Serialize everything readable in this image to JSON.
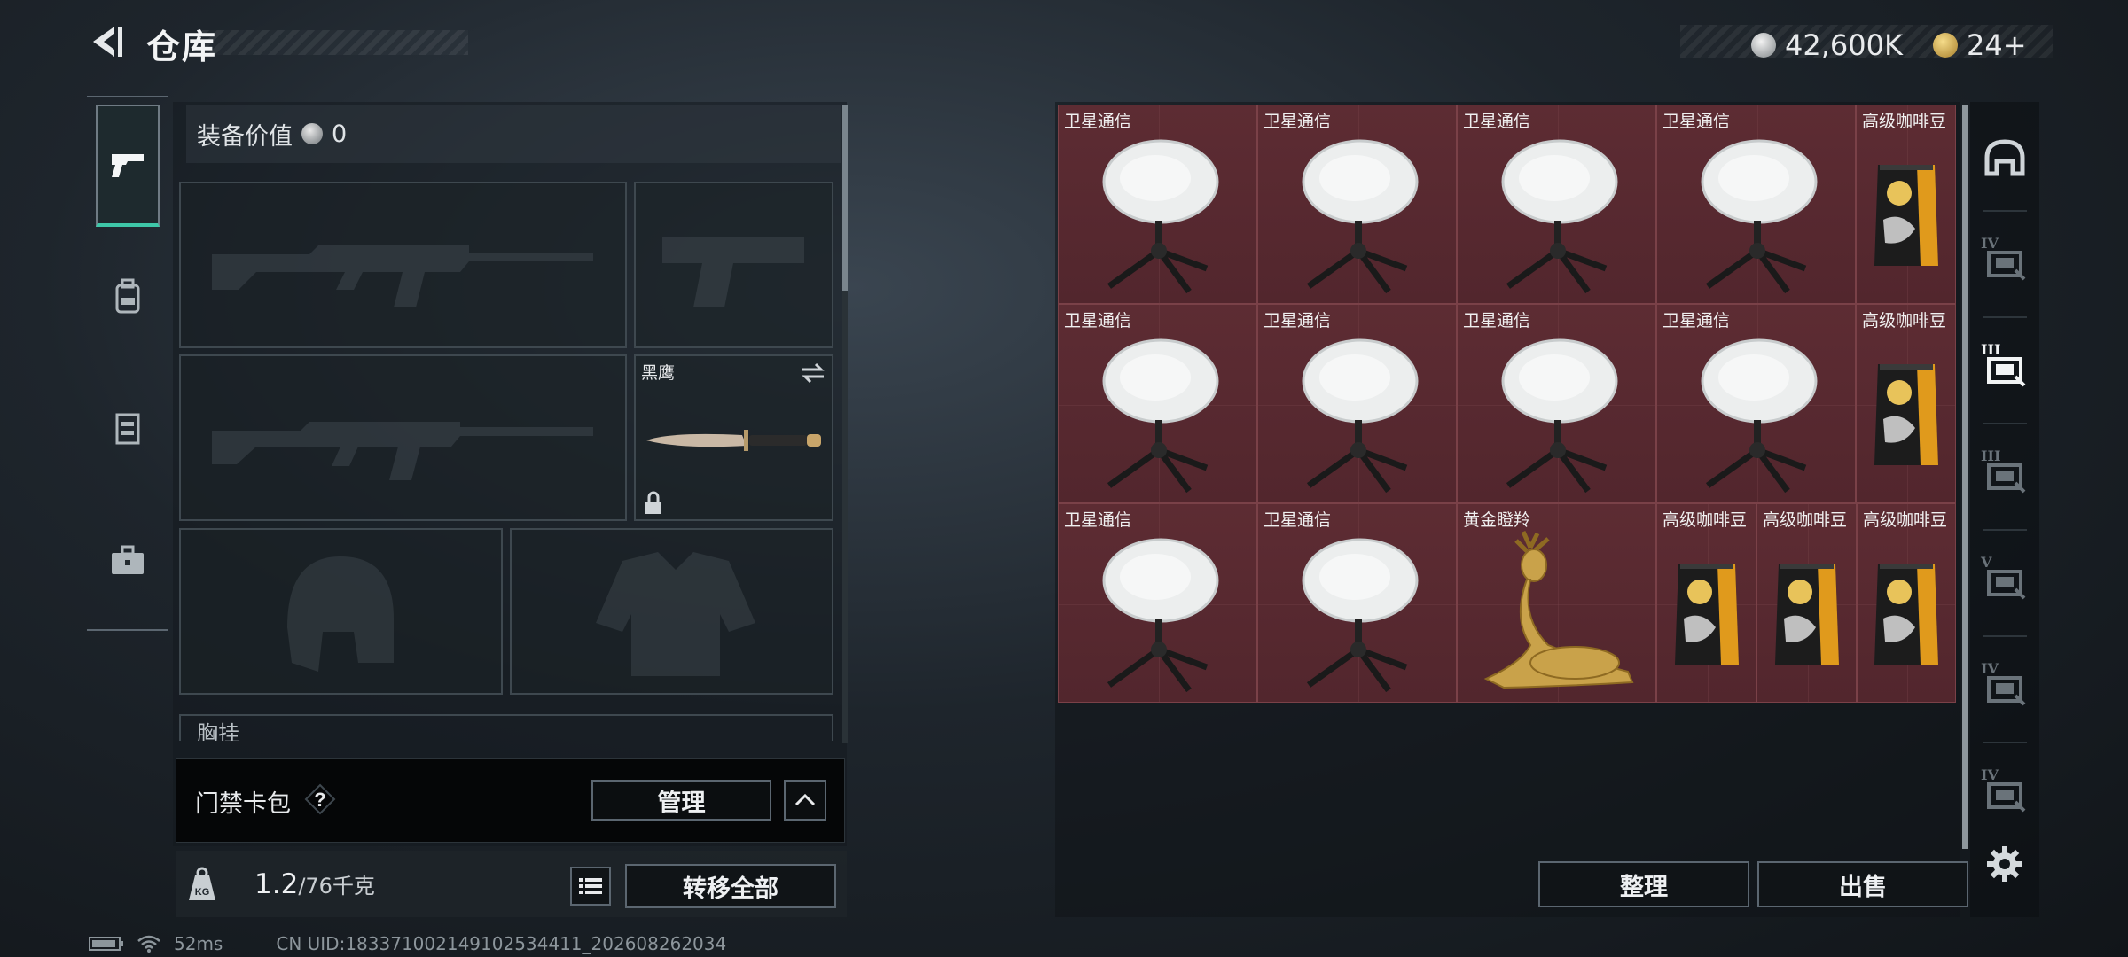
{
  "header": {
    "title": "仓库",
    "currency_primary": "42,600K",
    "currency_secondary": "24+"
  },
  "left_tabs": [
    {
      "icon": "pistol-icon",
      "active": true
    },
    {
      "icon": "backpack-icon",
      "active": false
    },
    {
      "icon": "vest-icon",
      "active": false
    },
    {
      "icon": "briefcase-icon",
      "active": false
    }
  ],
  "equipment": {
    "value_label": "装备价值",
    "value": "0",
    "melee_name": "黑鹰",
    "chest_label": "胸挂",
    "keycard_label": "门禁卡包",
    "manage_label": "管理",
    "weight_current": "1.2",
    "weight_max": "/76千克",
    "transfer_all_label": "转移全部"
  },
  "storage": {
    "rows": [
      [
        {
          "name": "卫星通信",
          "kind": "satellite"
        },
        {
          "name": "卫星通信",
          "kind": "satellite"
        },
        {
          "name": "卫星通信",
          "kind": "satellite"
        },
        {
          "name": "卫星通信",
          "kind": "satellite"
        },
        {
          "name": "高级咖啡豆",
          "kind": "coffee"
        }
      ],
      [
        {
          "name": "卫星通信",
          "kind": "satellite"
        },
        {
          "name": "卫星通信",
          "kind": "satellite"
        },
        {
          "name": "卫星通信",
          "kind": "satellite"
        },
        {
          "name": "卫星通信",
          "kind": "satellite"
        },
        {
          "name": "高级咖啡豆",
          "kind": "coffee"
        }
      ],
      [
        {
          "name": "卫星通信",
          "kind": "satellite"
        },
        {
          "name": "卫星通信",
          "kind": "satellite"
        },
        {
          "name": "黄金瞪羚",
          "kind": "gazelle"
        },
        {
          "name": "高级咖啡豆",
          "kind": "coffee"
        },
        {
          "name": "高级咖啡豆",
          "kind": "coffee"
        },
        {
          "name": "高级咖啡豆",
          "kind": "coffee"
        }
      ]
    ],
    "sort_label": "整理",
    "sell_label": "出售"
  },
  "right_tabs": [
    {
      "icon": "helmet-icon",
      "label": ""
    },
    {
      "icon": "tier-iv-case-icon",
      "label": "IV"
    },
    {
      "icon": "tier-iii-case-icon",
      "label": "III"
    },
    {
      "icon": "tier-iii-case-icon",
      "label": "III"
    },
    {
      "icon": "tier-v-case-icon",
      "label": "V"
    },
    {
      "icon": "tier-iv-case-icon",
      "label": "IV"
    },
    {
      "icon": "tier-iv-case-icon",
      "label": "IV"
    }
  ],
  "status_bar": {
    "ping": "52ms",
    "uid": "CN UID:18337100214910253441​1_202608262034"
  },
  "colors": {
    "accent": "#3ec7a8",
    "grid_cell": "#5a2a31",
    "button_border": "#5b6670"
  }
}
